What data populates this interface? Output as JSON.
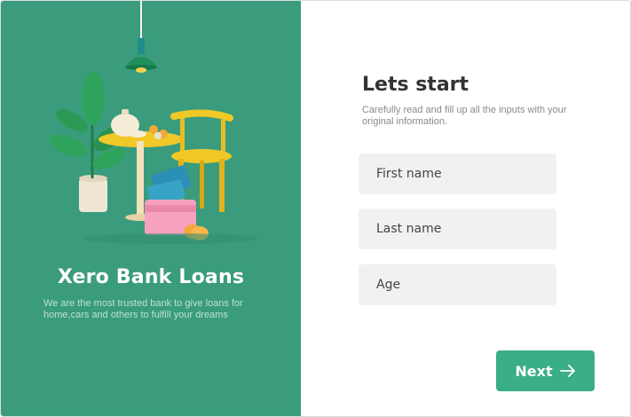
{
  "brand": {
    "title": "Xero Bank Loans",
    "description": "We are the most trusted bank to give loans for home,cars and others to fulfill your dreams"
  },
  "form": {
    "title": "Lets start",
    "description": "Carefully read and fill up all the inputs with your original information.",
    "fields": [
      {
        "placeholder": "First name",
        "value": ""
      },
      {
        "placeholder": "Last name",
        "value": ""
      },
      {
        "placeholder": "Age",
        "value": ""
      }
    ],
    "next_label": "Next",
    "next_icon": "arrow-right-icon"
  },
  "colors": {
    "panel_green": "#3a9c7c",
    "button_green": "#3aae86",
    "input_bg": "#f1f1f1"
  }
}
